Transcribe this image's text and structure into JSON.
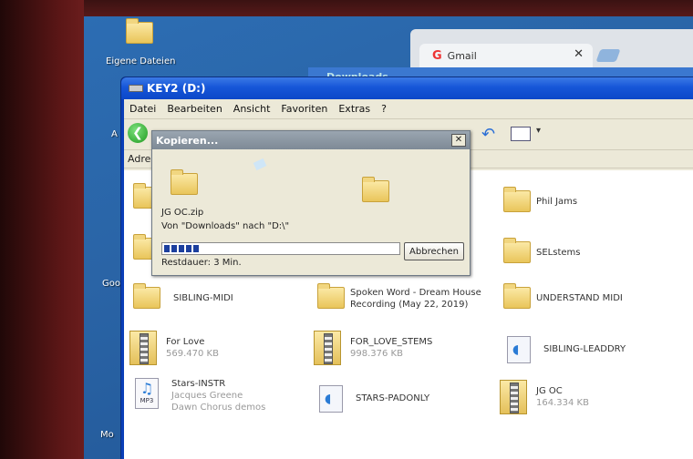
{
  "desktop": {
    "icon_label": "Eigene Dateien",
    "left_labels": [
      "A",
      "Goo",
      "Mo"
    ]
  },
  "chrome": {
    "tab_title": "Gmail",
    "logo_letter": "G",
    "close_glyph": "✕"
  },
  "downloads_window": {
    "title": "Downloads"
  },
  "explorer": {
    "title": "KEY2 (D:)",
    "menu": [
      "Datei",
      "Bearbeiten",
      "Ansicht",
      "Favoriten",
      "Extras",
      "?"
    ],
    "address_label": "Adresse",
    "items": [
      {
        "name": "Phil Jams",
        "sub": "",
        "type": "folder"
      },
      {
        "name": "SELstems",
        "sub": "",
        "type": "folder"
      },
      {
        "name": "SIBLING-MIDI",
        "sub": "",
        "type": "folder"
      },
      {
        "name": "Spoken Word - Dream House Recording (May 22, 2019)",
        "sub": "",
        "type": "folder"
      },
      {
        "name": "UNDERSTAND MIDI",
        "sub": "",
        "type": "folder"
      },
      {
        "name": "For Love",
        "sub": "569.470 KB",
        "type": "zip"
      },
      {
        "name": "FOR_LOVE_STEMS",
        "sub": "998.376 KB",
        "type": "zip"
      },
      {
        "name": "SIBLING-LEADDRY",
        "sub": "",
        "type": "wav"
      },
      {
        "name": "Stars-INSTR",
        "sub": "Jacques Greene",
        "sub2": "Dawn Chorus demos",
        "type": "mp3"
      },
      {
        "name": "STARS-PADONLY",
        "sub": "",
        "type": "wav"
      },
      {
        "name": "JG OC",
        "sub": "164.334 KB",
        "type": "zip"
      }
    ]
  },
  "copy_dialog": {
    "title": "Kopieren...",
    "close_glyph": "✕",
    "file": "JG OC.zip",
    "route": "Von \"Downloads\" nach \"D:\\\"",
    "progress": 0.15,
    "remaining": "Restdauer: 3 Min.",
    "cancel_label": "Abbrechen"
  },
  "icons": {
    "mp3_label": "MP3"
  }
}
